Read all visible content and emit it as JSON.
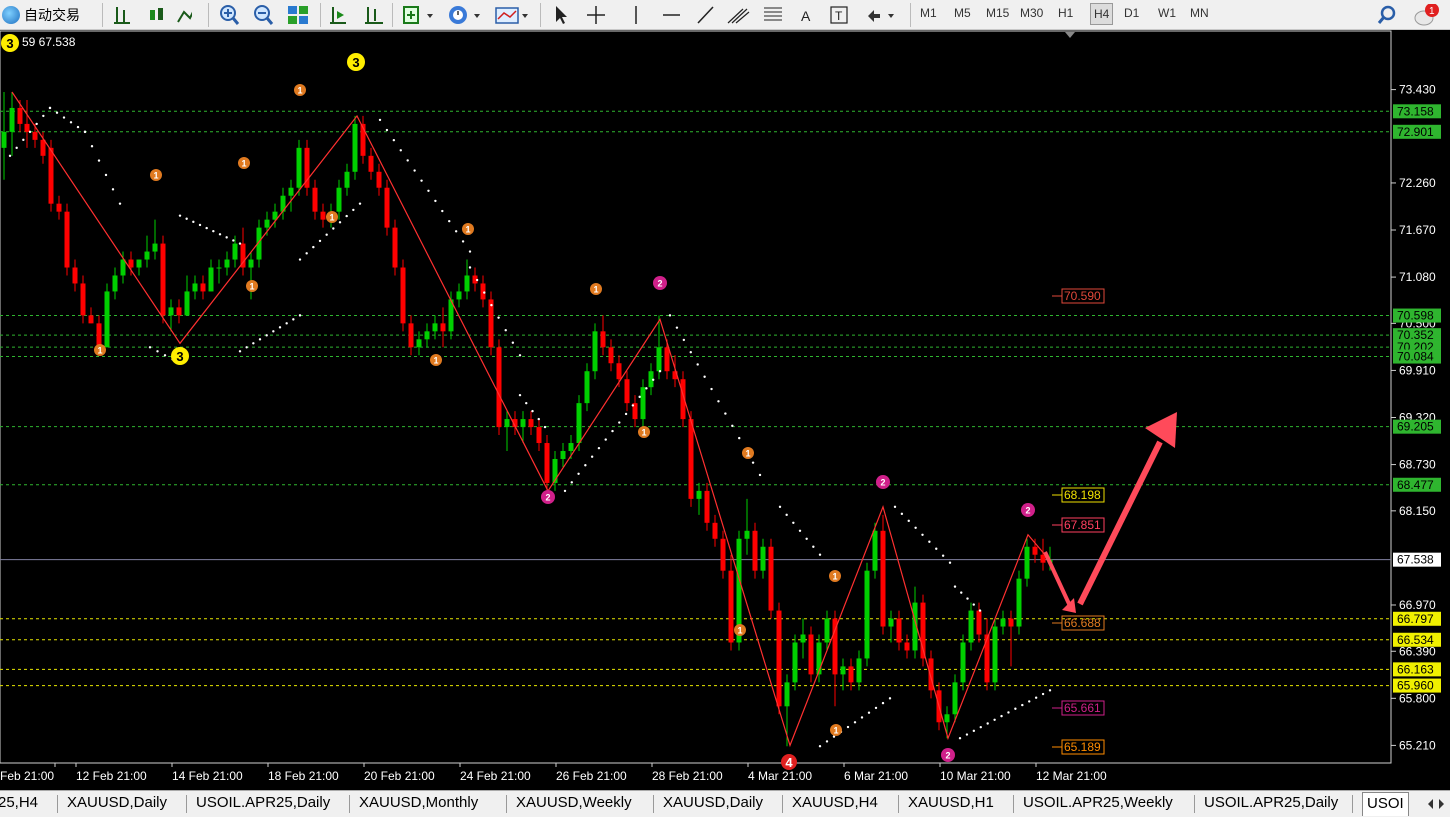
{
  "toolbar": {
    "autotrade_label": "自动交易",
    "timeframes": [
      "M1",
      "M5",
      "M15",
      "M30",
      "H1",
      "H4",
      "D1",
      "W1",
      "MN"
    ],
    "active_timeframe": "H4",
    "notification_count": "1"
  },
  "chart": {
    "info_text": "59 67.538",
    "current_price": "67.538",
    "price_axis": [
      "73.430",
      "72.260",
      "71.670",
      "71.080",
      "70.500",
      "69.910",
      "69.320",
      "68.730",
      "68.150",
      "66.970",
      "66.390",
      "65.800",
      "65.210"
    ],
    "green_levels": [
      "73.158",
      "72.901",
      "70.598",
      "70.352",
      "70.202",
      "70.084",
      "69.205",
      "68.477"
    ],
    "yellow_levels": [
      "66.797",
      "66.534",
      "66.163",
      "65.960"
    ],
    "chart_labels": [
      "70.590",
      "68.198",
      "67.851",
      "66.688",
      "65.661",
      "65.189"
    ],
    "time_axis": [
      "Feb 21:00",
      "12 Feb 21:00",
      "14 Feb 21:00",
      "18 Feb 21:00",
      "20 Feb 21:00",
      "24 Feb 21:00",
      "26 Feb 21:00",
      "28 Feb 21:00",
      "4 Mar 21:00",
      "6 Mar 21:00",
      "10 Mar 21:00",
      "12 Mar 21:00"
    ],
    "wave_markers": [
      "3",
      "3",
      "3",
      "1",
      "1",
      "1",
      "1",
      "1",
      "1",
      "1",
      "1",
      "1",
      "1",
      "1",
      "1",
      "1",
      "1",
      "2",
      "2",
      "2",
      "2",
      "2",
      "2",
      "4"
    ],
    "colors": {
      "bull": "#00d000",
      "bear": "#ff0000",
      "grid_green": "#2fb52f",
      "grid_yellow": "#e6e600",
      "zigzag": "#ff3030",
      "arrow": "#ff4a5a",
      "current": "#8080a0"
    }
  },
  "tabs": {
    "items": [
      "25,H4",
      "XAUUSD,Daily",
      "USOIL.APR25,Daily",
      "XAUUSD,Monthly",
      "XAUUSD,Weekly",
      "XAUUSD,Daily",
      "XAUUSD,H4",
      "XAUUSD,H1",
      "USOIL.APR25,Weekly",
      "USOIL.APR25,Daily",
      "USOI"
    ],
    "active_index": 10
  }
}
